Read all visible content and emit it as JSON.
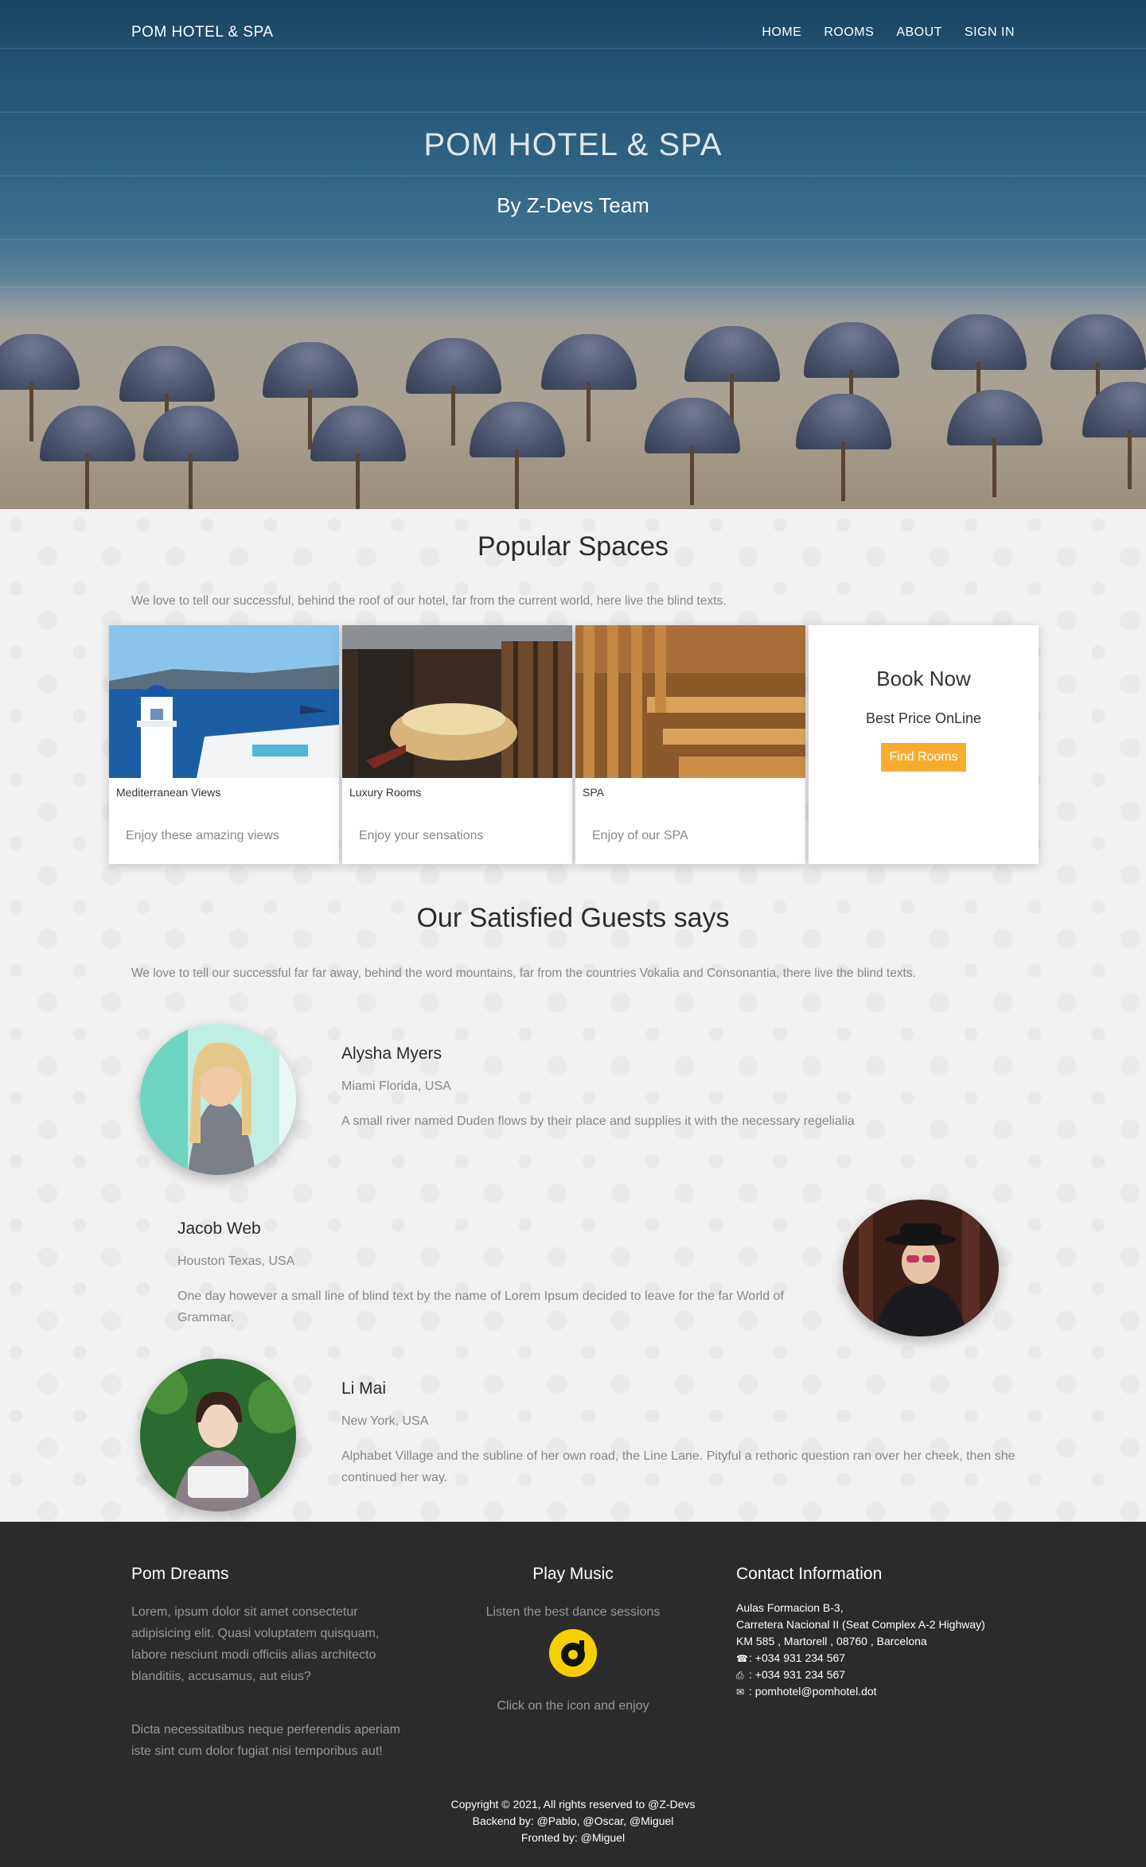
{
  "nav": {
    "brand": "POM HOTEL & SPA",
    "items": [
      "HOME",
      "ROOMS",
      "ABOUT",
      "SIGN IN"
    ]
  },
  "hero": {
    "title": "POM HOTEL & SPA",
    "subtitle": "By Z-Devs Team"
  },
  "popular": {
    "heading": "Popular Spaces",
    "lead": "We love to tell our successful, behind the roof of our hotel, far from the current world, here live the blind texts.",
    "cards": [
      {
        "caption": "Mediterranean Views",
        "desc": "Enjoy these amazing views"
      },
      {
        "caption": "Luxury Rooms",
        "desc": "Enjoy your sensations"
      },
      {
        "caption": "SPA",
        "desc": "Enjoy of our SPA"
      }
    ],
    "book": {
      "title": "Book Now",
      "subtitle": "Best Price OnLine",
      "button": "Find Rooms"
    }
  },
  "guests": {
    "heading": "Our Satisfied Guests says",
    "lead": "We love to tell our successful far far away, behind the word mountains, far from the countries Vokalia and Consonantia, there live the blind texts.",
    "items": [
      {
        "name": "Alysha Myers",
        "location": "Miami Florida, USA",
        "text": "A small river named Duden flows by their place and supplies it with the necessary regelialia"
      },
      {
        "name": "Jacob Web",
        "location": "Houston Texas, USA",
        "text": "One day however a small line of blind text by the name of Lorem Ipsum decided to leave for the far World of Grammar."
      },
      {
        "name": "Li Mai",
        "location": "New York, USA",
        "text": "Alphabet Village and the subline of her own road, the Line Lane. Pityful a rethoric question ran over her cheek, then she continued her way."
      }
    ]
  },
  "footer": {
    "col1": {
      "heading": "Pom Dreams",
      "p1": "Lorem, ipsum dolor sit amet consectetur adipisicing elit. Quasi voluptatem quisquam, labore nesciunt modi officiis alias architecto blanditiis, accusamus, aut eius?",
      "p2": "Dicta necessitatibus neque perferendis aperiam iste sint cum dolor fugiat nisi temporibus aut!"
    },
    "col2": {
      "heading": "Play Music",
      "top": "Listen the best dance sessions",
      "bottom": "Click on the icon and enjoy"
    },
    "col3": {
      "heading": "Contact Information",
      "address1": "Aulas Formacion B-3,",
      "address2": "Carretera Nacional II (Seat Complex A-2 Highway)",
      "address3": "KM 585 , Martorell , 08760 , Barcelona",
      "phone": ": +034 931 234 567",
      "fax": ": +034 931 234 567",
      "email": ": pomhotel@pomhotel.dot"
    },
    "copyright": "Copyright © 2021, All rights reserved to @Z-Devs",
    "backend": "Backend by: @Pablo, @Oscar, @Miguel",
    "frontend": "Fronted by: @Miguel"
  },
  "colors": {
    "accent": "#f6ad2e",
    "footer_bg": "#2b2b2b",
    "music_icon": "#f5d000"
  }
}
